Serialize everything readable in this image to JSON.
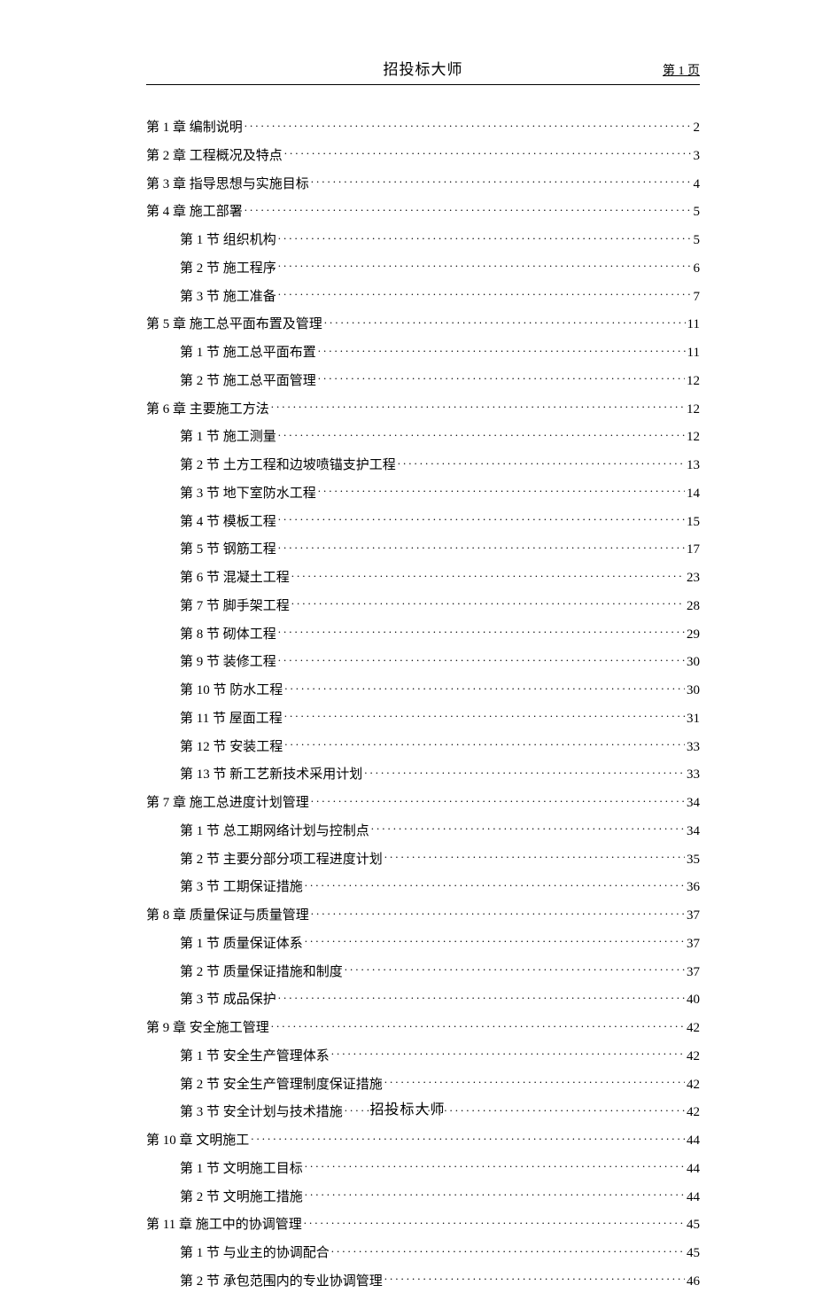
{
  "header": {
    "title": "招投标大师",
    "page_label": "第 1 页"
  },
  "footer": {
    "text": "招投标大师"
  },
  "toc": [
    {
      "level": 0,
      "label": "第 1 章  编制说明",
      "page": "2"
    },
    {
      "level": 0,
      "label": "第 2 章  工程概况及特点",
      "page": "3"
    },
    {
      "level": 0,
      "label": "第 3 章  指导思想与实施目标",
      "page": "4"
    },
    {
      "level": 0,
      "label": "第 4 章  施工部署",
      "page": "5"
    },
    {
      "level": 1,
      "label": "第 1 节  组织机构",
      "page": "5"
    },
    {
      "level": 1,
      "label": "第 2 节  施工程序",
      "page": "6"
    },
    {
      "level": 1,
      "label": "第 3 节  施工准备",
      "page": "7"
    },
    {
      "level": 0,
      "label": "第 5 章  施工总平面布置及管理",
      "page": "11"
    },
    {
      "level": 1,
      "label": "第 1 节  施工总平面布置",
      "page": "11"
    },
    {
      "level": 1,
      "label": "第 2 节  施工总平面管理",
      "page": "12"
    },
    {
      "level": 0,
      "label": "第 6 章  主要施工方法",
      "page": "12"
    },
    {
      "level": 1,
      "label": "第 1 节  施工测量",
      "page": "12"
    },
    {
      "level": 1,
      "label": "第 2 节  土方工程和边坡喷锚支护工程",
      "page": "13"
    },
    {
      "level": 1,
      "label": "第 3 节  地下室防水工程",
      "page": "14"
    },
    {
      "level": 1,
      "label": "第 4 节  模板工程",
      "page": "15"
    },
    {
      "level": 1,
      "label": "第 5 节  钢筋工程",
      "page": "17"
    },
    {
      "level": 1,
      "label": "第 6 节  混凝土工程",
      "page": "23"
    },
    {
      "level": 1,
      "label": "第 7 节  脚手架工程",
      "page": "28"
    },
    {
      "level": 1,
      "label": "第 8 节  砌体工程",
      "page": "29"
    },
    {
      "level": 1,
      "label": "第 9 节  装修工程",
      "page": "30"
    },
    {
      "level": 1,
      "label": "第 10 节  防水工程",
      "page": "30"
    },
    {
      "level": 1,
      "label": "第 11 节  屋面工程",
      "page": "31"
    },
    {
      "level": 1,
      "label": "第 12 节  安装工程",
      "page": "33"
    },
    {
      "level": 1,
      "label": "第 13 节  新工艺新技术采用计划",
      "page": "33"
    },
    {
      "level": 0,
      "label": "第 7 章  施工总进度计划管理",
      "page": "34"
    },
    {
      "level": 1,
      "label": "第 1 节  总工期网络计划与控制点",
      "page": "34"
    },
    {
      "level": 1,
      "label": "第 2 节  主要分部分项工程进度计划",
      "page": "35"
    },
    {
      "level": 1,
      "label": "第 3 节  工期保证措施",
      "page": "36"
    },
    {
      "level": 0,
      "label": "第 8 章  质量保证与质量管理",
      "page": "37"
    },
    {
      "level": 1,
      "label": "第 1 节  质量保证体系",
      "page": "37"
    },
    {
      "level": 1,
      "label": "第 2 节  质量保证措施和制度",
      "page": "37"
    },
    {
      "level": 1,
      "label": "第 3 节  成品保护",
      "page": "40"
    },
    {
      "level": 0,
      "label": "第 9 章  安全施工管理",
      "page": "42"
    },
    {
      "level": 1,
      "label": "第 1 节  安全生产管理体系",
      "page": "42"
    },
    {
      "level": 1,
      "label": "第 2 节  安全生产管理制度保证措施",
      "page": "42"
    },
    {
      "level": 1,
      "label": "第 3 节  安全计划与技术措施",
      "page": "42"
    },
    {
      "level": 0,
      "label": "第 10 章  文明施工",
      "page": "44"
    },
    {
      "level": 1,
      "label": "第 1 节  文明施工目标",
      "page": "44"
    },
    {
      "level": 1,
      "label": "第 2 节  文明施工措施",
      "page": "44"
    },
    {
      "level": 0,
      "label": "第 11 章  施工中的协调管理",
      "page": "45"
    },
    {
      "level": 1,
      "label": "第 1 节  与业主的协调配合",
      "page": "45"
    },
    {
      "level": 1,
      "label": "第 2 节  承包范围内的专业协调管理",
      "page": "46"
    }
  ]
}
